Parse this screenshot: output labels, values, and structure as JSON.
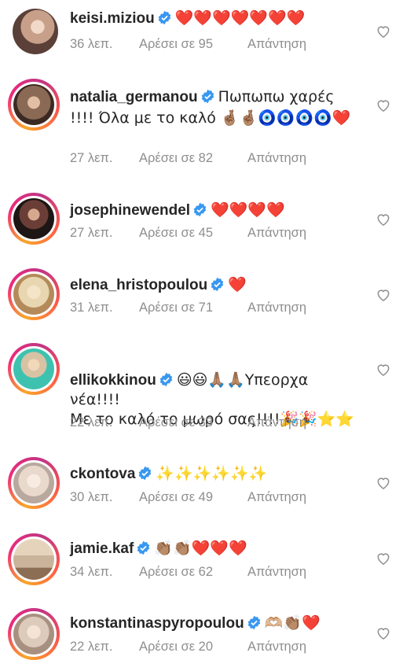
{
  "comments": [
    {
      "username": "keisi.miziou",
      "text": "❤️❤️❤️❤️❤️❤️❤️",
      "time": "36 λεπ.",
      "likes": "Αρέσει σε 95",
      "reply": "Απάντηση",
      "avatar_color": "#c8a08a",
      "story_ring": false
    },
    {
      "username": "natalia_germanou",
      "text": "Πωπωπω χαρές !!!! Όλα με το καλό 🤞🏽🤞🏽🧿🧿🧿🧿❤️",
      "time": "27 λεπ.",
      "likes": "Αρέσει σε 82",
      "reply": "Απάντηση",
      "avatar_color": "#8a6a55",
      "story_ring": true
    },
    {
      "username": "josephinewendel",
      "text": "❤️❤️❤️❤️",
      "time": "27 λεπ.",
      "likes": "Αρέσει σε 45",
      "reply": "Απάντηση",
      "avatar_color": "#3a2a28",
      "story_ring": true
    },
    {
      "username": "elena_hristopoulou",
      "text": "❤️",
      "time": "31 λεπ.",
      "likes": "Αρέσει σε 71",
      "reply": "Απάντηση",
      "avatar_color": "#e8d6b0",
      "story_ring": true
    },
    {
      "username": "ellikokkinou",
      "text": "😃😃🙏🏽🙏🏽Υπεορχα νέα!!!!\nΜε το καλό το μωρό σας!!!!🎉🎉⭐⭐",
      "time": "22 λεπ.",
      "likes": "Αρέσει σε 33",
      "reply": "Απάντηση",
      "avatar_color": "#d7c2a4",
      "story_ring": true
    },
    {
      "username": "ckontova",
      "text": "✨✨✨✨✨✨",
      "time": "30 λεπ.",
      "likes": "Αρέσει σε 49",
      "reply": "Απάντηση",
      "avatar_color": "#e9d8cc",
      "story_ring": true
    },
    {
      "username": "jamie.kaf",
      "text": "👏🏽👏🏽❤️❤️❤️",
      "time": "34 λεπ.",
      "likes": "Αρέσει σε 62",
      "reply": "Απάντηση",
      "avatar_color": "#c9b39a",
      "story_ring": true
    },
    {
      "username": "konstantinaspyropoulou",
      "text": "🫶🏼👏🏽❤️",
      "time": "22 λεπ.",
      "likes": "Αρέσει σε 20",
      "reply": "Απάντηση",
      "avatar_color": "#dccabb",
      "story_ring": true
    }
  ],
  "icons": {
    "verified": "verified-badge-icon",
    "like": "heart-outline-icon"
  },
  "colors": {
    "verified": "#3897f0",
    "meta_text": "#8e8e8e",
    "heart_outline": "#8e8e8e"
  }
}
